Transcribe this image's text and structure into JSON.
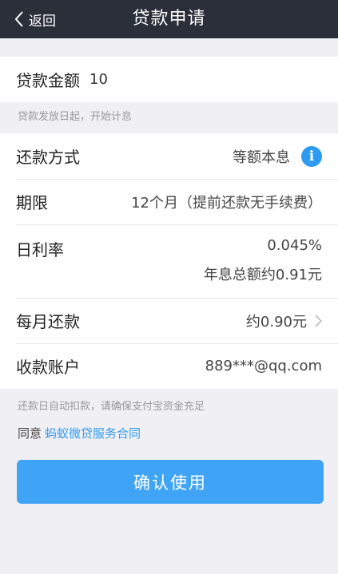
{
  "nav": {
    "back_label": "返回",
    "title": "贷款申请"
  },
  "amount": {
    "label": "贷款金额",
    "value": "10",
    "hint": "贷款发放日起，开始计息"
  },
  "repay_method": {
    "label": "还款方式",
    "value": "等额本息",
    "icon": "info-icon",
    "icon_glyph": "i"
  },
  "term": {
    "label": "期限",
    "value": "12个月（提前还款无手续费）"
  },
  "daily_rate": {
    "label": "日利率",
    "value": "0.045%",
    "annual_interest": "年息总额约0.91元"
  },
  "monthly_payment": {
    "label": "每月还款",
    "value": "约0.90元",
    "icon": "chevron-right-icon"
  },
  "account": {
    "label": "收款账户",
    "value": "889***@qq.com",
    "hint": "还款日自动扣款，请确保支付宝资金充足"
  },
  "agreement": {
    "prefix": "同意",
    "link": "蚂蚁微贷服务合同"
  },
  "confirm_label": "确认使用",
  "colors": {
    "navbar": "#2b2f3a",
    "accent": "#3fa4f5",
    "link": "#2f9bf0",
    "background": "#f0eff4"
  }
}
